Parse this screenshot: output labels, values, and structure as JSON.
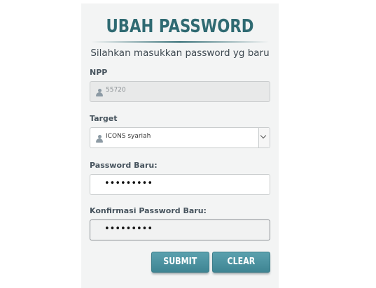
{
  "form": {
    "title": "UBAH PASSWORD",
    "subtitle": "Silahkan masukkan password yg baru",
    "npp": {
      "label": "NPP",
      "value": "55720"
    },
    "target": {
      "label": "Target",
      "selected": "ICONS syariah"
    },
    "password_baru": {
      "label": "Password Baru:",
      "masked": "•••••••••"
    },
    "konfirmasi": {
      "label": "Konfirmasi Password Baru:",
      "masked": "•••••••••"
    },
    "submit_label": "SUBMIT",
    "clear_label": "CLEAR"
  },
  "colors": {
    "title": "#2f6a72",
    "button": "#4a90a0",
    "panel_bg": "#f3f4f4"
  },
  "icons": {
    "user": "user-icon",
    "dropdown": "chevron-down-icon"
  }
}
